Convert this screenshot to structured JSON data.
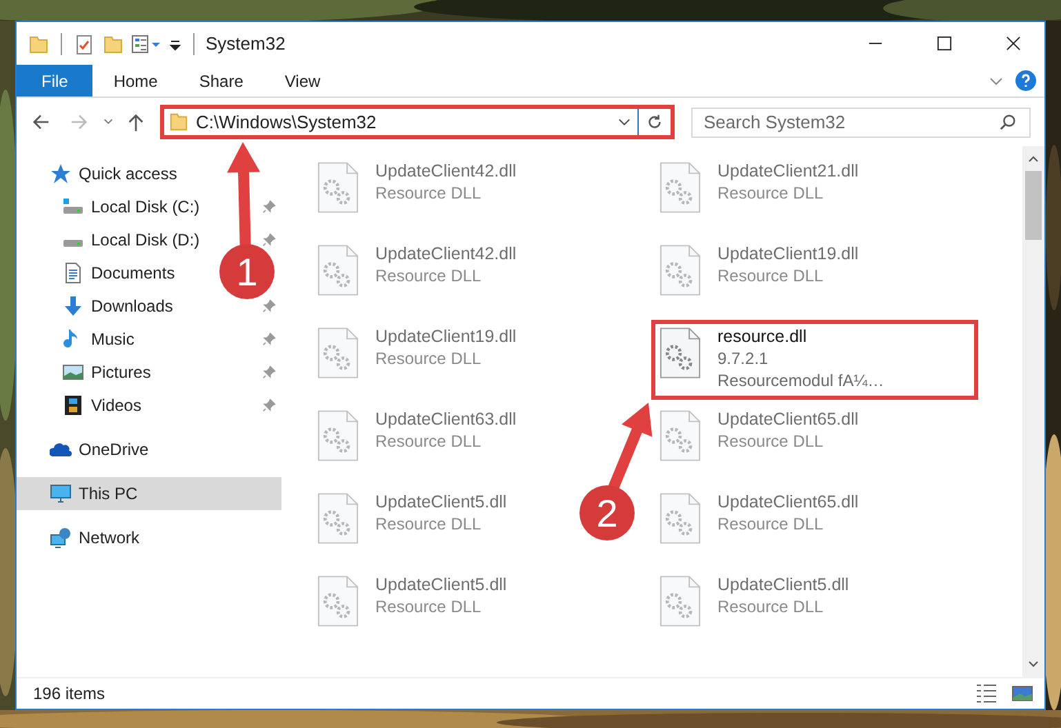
{
  "window": {
    "title": "System32"
  },
  "ribbon_tabs": [
    {
      "label": "File",
      "kind": "file_menu"
    },
    {
      "label": "Home",
      "kind": "tab"
    },
    {
      "label": "Share",
      "kind": "tab"
    },
    {
      "label": "View",
      "kind": "tab"
    }
  ],
  "address": {
    "path": "C:\\Windows\\System32",
    "highlighted": true
  },
  "search": {
    "placeholder": "Search System32"
  },
  "nav": [
    {
      "label": "Quick access",
      "kind": "quick",
      "selected": false,
      "children": [
        {
          "label": "Local Disk (C:)",
          "kind": "drive_c",
          "pinned": true,
          "selected": false
        },
        {
          "label": "Local Disk (D:)",
          "kind": "drive",
          "pinned": true,
          "selected": false
        },
        {
          "label": "Documents",
          "kind": "documents",
          "pinned": false,
          "selected": false
        },
        {
          "label": "Downloads",
          "kind": "downloads",
          "pinned": true,
          "selected": false
        },
        {
          "label": "Music",
          "kind": "music",
          "pinned": true,
          "selected": false
        },
        {
          "label": "Pictures",
          "kind": "pictures",
          "pinned": true,
          "selected": false
        },
        {
          "label": "Videos",
          "kind": "videos",
          "pinned": true,
          "selected": false
        }
      ]
    },
    {
      "label": "OneDrive",
      "kind": "onedrive",
      "selected": false
    },
    {
      "label": "This PC",
      "kind": "pc",
      "selected": true
    },
    {
      "label": "Network",
      "kind": "network",
      "selected": false
    }
  ],
  "files": [
    {
      "name": "UpdateClient42.dll",
      "details": [
        "Resource DLL"
      ],
      "blurred": true,
      "highlighted": false
    },
    {
      "name": "UpdateClient21.dll",
      "details": [
        "Resource DLL"
      ],
      "blurred": true,
      "highlighted": false
    },
    {
      "name": "UpdateClient42.dll",
      "details": [
        "Resource DLL"
      ],
      "blurred": true,
      "highlighted": false
    },
    {
      "name": "UpdateClient19.dll",
      "details": [
        "Resource DLL"
      ],
      "blurred": true,
      "highlighted": false
    },
    {
      "name": "UpdateClient19.dll",
      "details": [
        "Resource DLL"
      ],
      "blurred": true,
      "highlighted": false
    },
    {
      "name": "resource.dll",
      "details": [
        "9.7.2.1",
        "Resourcemodul fA¼…"
      ],
      "blurred": false,
      "highlighted": true
    },
    {
      "name": "UpdateClient63.dll",
      "details": [
        "Resource DLL"
      ],
      "blurred": true,
      "highlighted": false
    },
    {
      "name": "UpdateClient65.dll",
      "details": [
        "Resource DLL"
      ],
      "blurred": true,
      "highlighted": false
    },
    {
      "name": "UpdateClient5.dll",
      "details": [
        "Resource DLL"
      ],
      "blurred": true,
      "highlighted": false
    },
    {
      "name": "UpdateClient65.dll",
      "details": [
        "Resource DLL"
      ],
      "blurred": true,
      "highlighted": false
    },
    {
      "name": "UpdateClient5.dll",
      "details": [
        "Resource DLL"
      ],
      "blurred": true,
      "highlighted": false
    },
    {
      "name": "UpdateClient5.dll",
      "details": [
        "Resource DLL"
      ],
      "blurred": true,
      "highlighted": false
    }
  ],
  "status_bar": {
    "item_count": "196 items"
  },
  "annotations": [
    {
      "label": "1"
    },
    {
      "label": "2"
    }
  ]
}
